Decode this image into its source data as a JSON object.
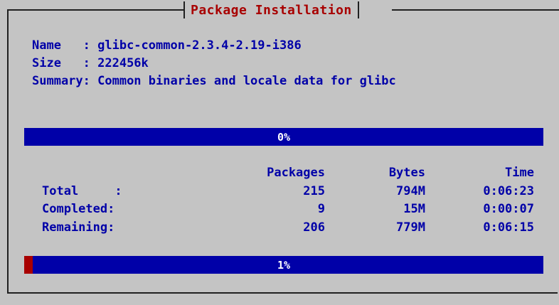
{
  "dialog": {
    "title": "Package Installation"
  },
  "package": {
    "name_label": "Name   : ",
    "name": "glibc-common-2.3.4-2.19-i386",
    "size_label": "Size   : ",
    "size": "222456k",
    "summary_label": "Summary: ",
    "summary": "Common binaries and locale data for glibc"
  },
  "package_progress": {
    "label": "0%",
    "fraction": 0.0
  },
  "stats": {
    "headers": {
      "packages": "Packages",
      "bytes": "Bytes",
      "time": "Time"
    },
    "rows": [
      {
        "label": "Total     :",
        "packages": "215",
        "bytes": "794M",
        "time": "0:06:23"
      },
      {
        "label": "Completed:",
        "packages": "9",
        "bytes": "15M",
        "time": "0:00:07"
      },
      {
        "label": "Remaining:",
        "packages": "206",
        "bytes": "779M",
        "time": "0:06:15"
      }
    ]
  },
  "overall_progress": {
    "label": "1%",
    "fraction": 0.017
  },
  "colors": {
    "background": "#c4c4c4",
    "text": "#0000a8",
    "title": "#a80000",
    "bar": "#0000a8",
    "bar_fill": "#a80000"
  }
}
